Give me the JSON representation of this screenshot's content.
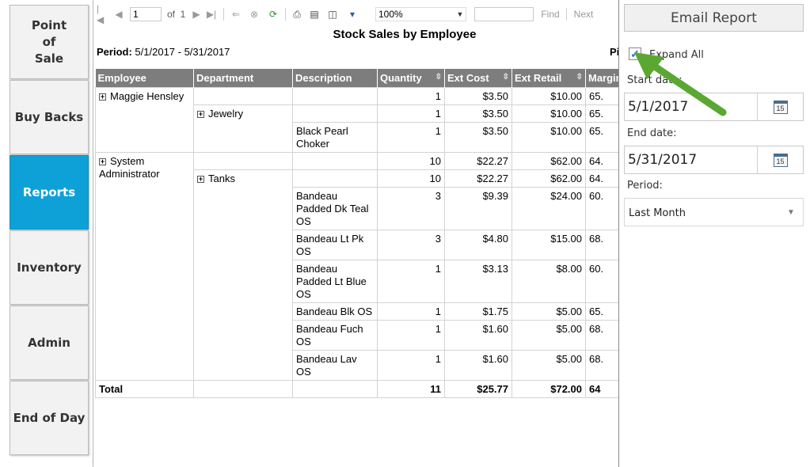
{
  "nav": {
    "items": [
      {
        "label": "Point\nof\nSale",
        "active": false
      },
      {
        "label": "Buy Backs",
        "active": false
      },
      {
        "label": "Reports",
        "active": true
      },
      {
        "label": "Inventory",
        "active": false
      },
      {
        "label": "Admin",
        "active": false
      },
      {
        "label": "End of Day",
        "active": false
      }
    ],
    "active_color": "#0ea1d8"
  },
  "toolbar": {
    "page_value": "1",
    "of_label": "of",
    "page_total": "1",
    "zoom": "100%",
    "search_value": "",
    "find_label": "Find",
    "next_label": "Next",
    "icons": [
      "first-page-icon",
      "prev-page-icon",
      "next-page-icon",
      "last-page-icon",
      "back-icon",
      "stop-icon",
      "refresh-icon",
      "print-icon",
      "print-layout-icon",
      "page-setup-icon",
      "export-icon"
    ]
  },
  "report": {
    "title": "Stock Sales by Employee",
    "period_label": "Period:",
    "period_value": "5/1/2017 - 5/31/2017",
    "page_label": "Pi",
    "columns": [
      "Employee",
      "Department",
      "Description",
      "Quantity",
      "Ext Cost",
      "Ext Retail",
      "Margin"
    ],
    "maggie": {
      "employee": "Maggie Hensley",
      "summary": {
        "qty": "1",
        "cost": "$3.50",
        "retail": "$10.00",
        "margin": "65."
      },
      "dept": "Jewelry",
      "dept_summary": {
        "qty": "1",
        "cost": "$3.50",
        "retail": "$10.00",
        "margin": "65."
      },
      "items": [
        {
          "desc": "Black Pearl Choker",
          "qty": "1",
          "cost": "$3.50",
          "retail": "$10.00",
          "margin": "65."
        }
      ]
    },
    "sysadmin": {
      "employee": "System Administrator",
      "summary": {
        "qty": "10",
        "cost": "$22.27",
        "retail": "$62.00",
        "margin": "64."
      },
      "dept": "Tanks",
      "dept_summary": {
        "qty": "10",
        "cost": "$22.27",
        "retail": "$62.00",
        "margin": "64."
      },
      "items": [
        {
          "desc": "Bandeau Padded Dk Teal OS",
          "qty": "3",
          "cost": "$9.39",
          "retail": "$24.00",
          "margin": "60."
        },
        {
          "desc": "Bandeau Lt Pk OS",
          "qty": "3",
          "cost": "$4.80",
          "retail": "$15.00",
          "margin": "68."
        },
        {
          "desc": "Bandeau Padded Lt Blue OS",
          "qty": "1",
          "cost": "$3.13",
          "retail": "$8.00",
          "margin": "60."
        },
        {
          "desc": "Bandeau Blk OS",
          "qty": "1",
          "cost": "$1.75",
          "retail": "$5.00",
          "margin": "65."
        },
        {
          "desc": "Bandeau Fuch OS",
          "qty": "1",
          "cost": "$1.60",
          "retail": "$5.00",
          "margin": "68."
        },
        {
          "desc": "Bandeau Lav OS",
          "qty": "1",
          "cost": "$1.60",
          "retail": "$5.00",
          "margin": "68."
        }
      ]
    },
    "total": {
      "label": "Total",
      "qty": "11",
      "cost": "$25.77",
      "retail": "$72.00",
      "margin": "64"
    }
  },
  "panel": {
    "email_label": "Email Report",
    "expand_all_label": "Expand All",
    "expand_all_checked": true,
    "start_label": "Start date:",
    "start_value": "5/1/2017",
    "end_label": "End date:",
    "end_value": "5/31/2017",
    "period_label": "Period:",
    "period_value": "Last Month",
    "calendar_day": "15"
  },
  "annotation": {
    "arrow_color": "#5aa832"
  }
}
